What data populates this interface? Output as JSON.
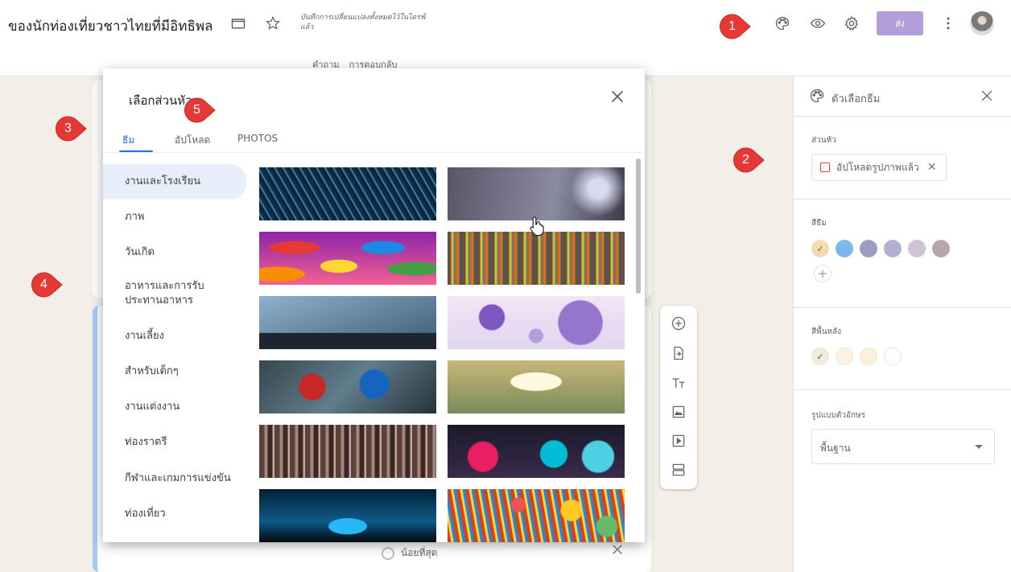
{
  "app": {
    "form_title": "ของนักท่องเที่ยวชาวไทยที่มีอิทธิพล",
    "save_note": "บันทึกการเปลี่ยนแปลงทั้งหมดไว้ในไดรฟ์แล้ว",
    "tabs": [
      "คำถาม",
      "การตอบกลับ"
    ],
    "send_label": "ส่ง"
  },
  "markers": [
    "1",
    "2",
    "3",
    "4",
    "5"
  ],
  "dialog": {
    "title": "เลือกส่วนหัว",
    "tabs": [
      "ธีม",
      "อัปโหลด",
      "PHOTOS"
    ],
    "active_tab": "ธีม",
    "categories": [
      "งานและโรงเรียน",
      "ภาพ",
      "วันเกิด",
      "อาหารและการรับประทานอาหาร",
      "งานเลี้ยง",
      "สำหรับเด็กๆ",
      "งานแต่งงาน",
      "ท่องราตรี",
      "กีฬาและเกมการแข่งขัน",
      "ท่องเที่ยว"
    ],
    "active_category": "งานและโรงเรียน",
    "thumbnails": [
      {
        "name": "thumb-fiber-optic",
        "icon": "image"
      },
      {
        "name": "thumb-guitar",
        "icon": "image"
      },
      {
        "name": "thumb-candies",
        "icon": "image"
      },
      {
        "name": "thumb-yarn",
        "icon": "image"
      },
      {
        "name": "thumb-basketball",
        "icon": "image"
      },
      {
        "name": "thumb-molecules",
        "icon": "image"
      },
      {
        "name": "thumb-paint-hands",
        "icon": "image"
      },
      {
        "name": "thumb-book-heart",
        "icon": "image"
      },
      {
        "name": "thumb-brushes",
        "icon": "image"
      },
      {
        "name": "thumb-flasks",
        "icon": "image"
      },
      {
        "name": "thumb-microscope",
        "icon": "image"
      },
      {
        "name": "thumb-pencils",
        "icon": "image"
      }
    ]
  },
  "panel": {
    "title": "ตัวเลือกธีม",
    "header_section_label": "ส่วนหัว",
    "upload_chip_label": "อัปโหลดรูปภาพแล้ว",
    "theme_color_label": "สีธีม",
    "theme_colors": [
      "#f3ddb0",
      "#7cb9e8",
      "#9e9cc3",
      "#b3b0d6",
      "#cfc4d3",
      "#b6a6ad"
    ],
    "selected_theme_color": "#f3ddb0",
    "bg_color_label": "สีพื้นหลัง",
    "bg_colors": [
      "#f2ebdc",
      "#fcf3e2",
      "#faf1dc",
      "#ffffff"
    ],
    "selected_bg_color": "#f2ebdc",
    "font_label": "รูปแบบตัวอักษร",
    "font_value": "พื้นฐาน"
  },
  "form": {
    "option_label": "น้อยที่สุด"
  },
  "colors": {
    "accent": "#1a73e8",
    "send_button": "#b39ddb",
    "marker": "#e53935",
    "form_background": "#f4eee8"
  }
}
